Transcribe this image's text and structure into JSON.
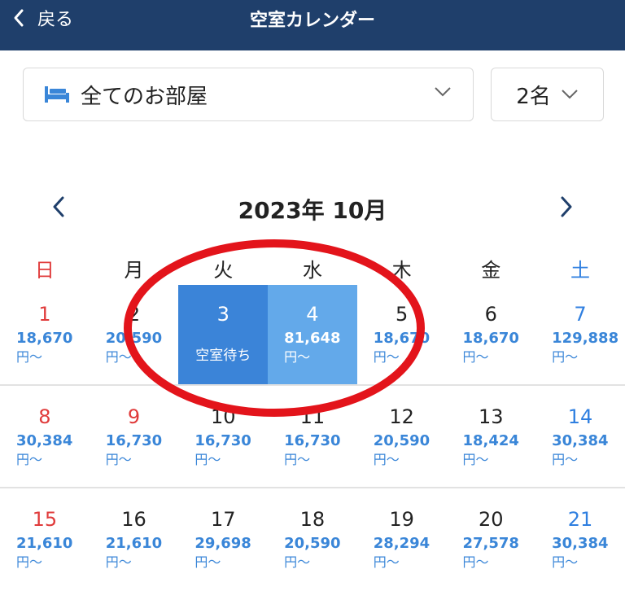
{
  "header": {
    "back_label": "戻る",
    "title": "空室カレンダー"
  },
  "filters": {
    "room": "全てのお部屋",
    "guests": "2名"
  },
  "calendar": {
    "month_label": "2023年 10月",
    "weekdays": [
      "日",
      "月",
      "火",
      "水",
      "木",
      "金",
      "土"
    ],
    "weeks": [
      [
        {
          "day": "1",
          "price": "18,670",
          "yen": "円〜"
        },
        {
          "day": "2",
          "price": "20,590",
          "yen": "円〜"
        },
        {
          "day": "3",
          "status": "空室待ち"
        },
        {
          "day": "4",
          "price": "81,648",
          "yen": "円〜"
        },
        {
          "day": "5",
          "price": "18,670",
          "yen": "円〜"
        },
        {
          "day": "6",
          "price": "18,670",
          "yen": "円〜"
        },
        {
          "day": "7",
          "price": "129,888",
          "yen": "円〜"
        }
      ],
      [
        {
          "day": "8",
          "price": "30,384",
          "yen": "円〜"
        },
        {
          "day": "9",
          "price": "16,730",
          "yen": "円〜"
        },
        {
          "day": "10",
          "price": "16,730",
          "yen": "円〜"
        },
        {
          "day": "11",
          "price": "16,730",
          "yen": "円〜"
        },
        {
          "day": "12",
          "price": "20,590",
          "yen": "円〜"
        },
        {
          "day": "13",
          "price": "18,424",
          "yen": "円〜"
        },
        {
          "day": "14",
          "price": "30,384",
          "yen": "円〜"
        }
      ],
      [
        {
          "day": "15",
          "price": "21,610",
          "yen": "円〜"
        },
        {
          "day": "16",
          "price": "21,610",
          "yen": "円〜"
        },
        {
          "day": "17",
          "price": "29,698",
          "yen": "円〜"
        },
        {
          "day": "18",
          "price": "20,590",
          "yen": "円〜"
        },
        {
          "day": "19",
          "price": "28,294",
          "yen": "円〜"
        },
        {
          "day": "20",
          "price": "27,578",
          "yen": "円〜"
        },
        {
          "day": "21",
          "price": "30,384",
          "yen": "円〜"
        }
      ]
    ]
  },
  "colors": {
    "header_bg": "#1f3f6b",
    "price_blue": "#3a86d8",
    "sunday_red": "#e03b3b",
    "saturday_blue": "#2f7fe0",
    "selected_start": "#3b84d8",
    "selected_end": "#63a9ea",
    "annotation_ring": "#e3141b"
  },
  "icons": {
    "back": "chevron-left-icon",
    "room": "bed-icon",
    "dropdown": "chevron-down-icon",
    "prev": "chevron-left-icon",
    "next": "chevron-right-icon"
  }
}
